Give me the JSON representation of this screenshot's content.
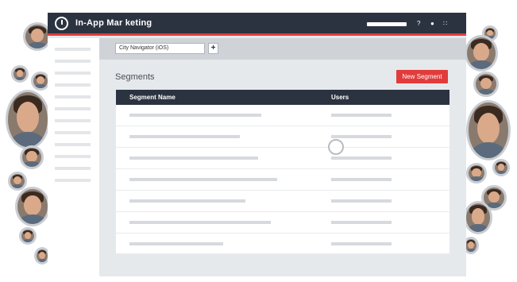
{
  "app": {
    "title": "In-App Mar keting"
  },
  "toolbar": {
    "selected_app": "City Navigator (iOS)",
    "add_label": "+"
  },
  "page": {
    "title": "Segments",
    "new_button": "New Segment"
  },
  "table": {
    "columns": [
      "Segment Name",
      "Users"
    ]
  },
  "header_icons": [
    "help-icon",
    "user-icon",
    "apps-grid-icon"
  ],
  "colors": {
    "nav_bg": "#2c3340",
    "accent": "#e23b3b",
    "content_bg": "#e6e9ec"
  }
}
